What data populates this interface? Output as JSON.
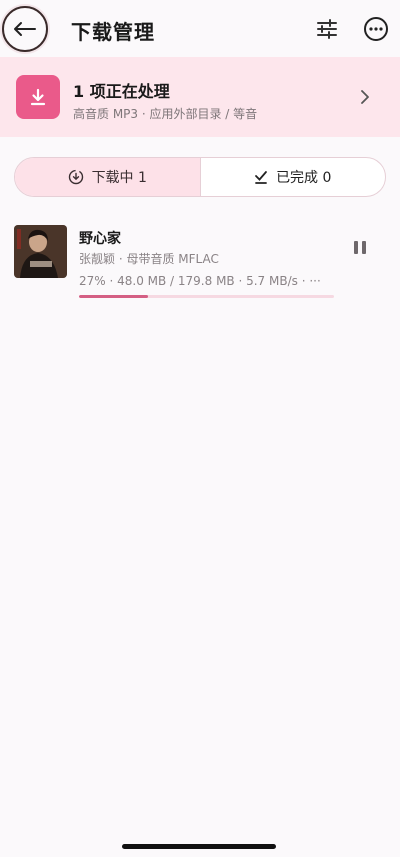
{
  "header": {
    "title": "下载管理",
    "back_icon": "arrow-left-icon",
    "filter_icon": "sliders-icon",
    "more_icon": "more-horizontal-icon"
  },
  "banner": {
    "title": "1 项正在处理",
    "subtitle": "高音质 MP3 · 应用外部目录 / 等音",
    "icon": "download-icon",
    "accent": "#ea5a8a"
  },
  "tabs": [
    {
      "label": "下载中 1",
      "icon": "download-circle-icon",
      "active": true
    },
    {
      "label": "已完成 0",
      "icon": "check-icon",
      "active": false
    }
  ],
  "downloads": [
    {
      "title": "野心家",
      "meta": "张靓颖 · 母带音质 MFLAC",
      "progress_text": "27% · 48.0 MB / 179.8 MB · 5.7 MB/s · ···",
      "progress": 0.27,
      "action_icon": "pause-icon"
    }
  ],
  "colors": {
    "banner_bg": "#fde6ec",
    "progress": "#d45f84",
    "track": "#f6d9e2"
  }
}
